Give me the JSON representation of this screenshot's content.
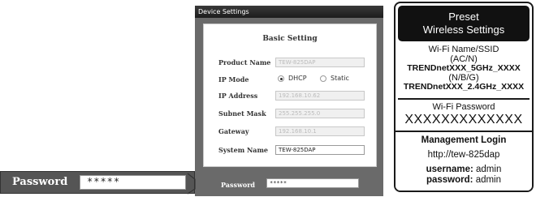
{
  "panel": {
    "title": "Device Settings",
    "heading": "Basic Setting",
    "fields": {
      "product_name": {
        "label": "Product Name",
        "value": "TEW-825DAP"
      },
      "ip_mode": {
        "label": "IP Mode",
        "option_dhcp": "DHCP",
        "option_static": "Static",
        "selected": "DHCP"
      },
      "ip_address": {
        "label": "IP Address",
        "value": "192.168.10.62"
      },
      "subnet_mask": {
        "label": "Subnet Mask",
        "value": "255.255.255.0"
      },
      "gateway": {
        "label": "Gateway",
        "value": "192.168.10.1"
      },
      "system_name": {
        "label": "System Name",
        "value": "TEW-825DAP"
      }
    },
    "password": {
      "label": "Password",
      "value": "*****"
    }
  },
  "zoom": {
    "label": "Password",
    "value": "*****"
  },
  "sticker": {
    "title_line1": "Preset",
    "title_line2": "Wireless Settings",
    "ssid_title_line1": "Wi-Fi Name/SSID",
    "ssid_title_line2": "(AC/N)",
    "ssid_5g": "TRENDnetXXX_5GHz_XXXX",
    "ssid_band_24": "(N/B/G)",
    "ssid_24g": "TRENDnetXXX_2.4GHz_XXXX",
    "wifi_password_title": "Wi-Fi Password",
    "wifi_password_value": "XXXXXXXXXXXXX",
    "management_title": "Management Login",
    "management_url": "http://tew-825dap",
    "username_label": "username:",
    "username_value": "admin",
    "password_label": "password:",
    "password_value": "admin"
  }
}
